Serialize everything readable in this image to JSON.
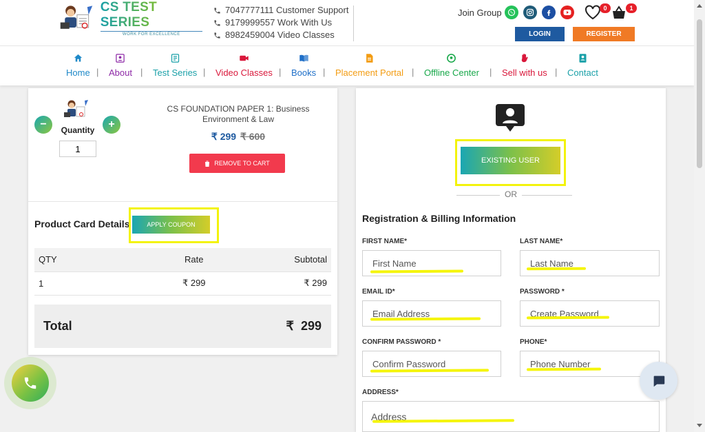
{
  "header": {
    "logo": {
      "title": "CS TEST SERIES",
      "tagline": "WORK FOR EXCELLENCE"
    },
    "contacts": [
      "7047777111 Customer Support",
      "9179999557 Work With Us",
      "8982459004 Video Classes"
    ],
    "join_group": "Join Group",
    "social_icons": [
      "whatsapp-icon",
      "instagram-icon",
      "facebook-icon",
      "youtube-icon"
    ],
    "wishlist_count": "0",
    "cart_count": "1",
    "login_label": "LOGIN",
    "register_label": "REGISTER"
  },
  "nav": {
    "items": [
      {
        "label": "Home",
        "icon": "home-icon",
        "color": "#1f89c8"
      },
      {
        "label": "About",
        "icon": "about-icon",
        "color": "#8e2aa7"
      },
      {
        "label": "Test Series",
        "icon": "list-icon",
        "color": "#1aa0a8"
      },
      {
        "label": "Video Classes",
        "icon": "video-icon",
        "color": "#d9183b"
      },
      {
        "label": "Books",
        "icon": "book-icon",
        "color": "#1f6fc8"
      },
      {
        "label": "Placement Portal",
        "icon": "document-icon",
        "color": "#f39c12"
      },
      {
        "label": "Offline Center",
        "icon": "location-icon",
        "color": "#18a84a"
      },
      {
        "label": "Sell with us",
        "icon": "hand-icon",
        "color": "#d9183b"
      },
      {
        "label": "Contact",
        "icon": "contact-icon",
        "color": "#1aa0a8"
      }
    ],
    "separator": "|"
  },
  "cart": {
    "minus": "−",
    "plus": "+",
    "quantity_label": "Quantity",
    "quantity_value": "1",
    "product_title": "CS FOUNDATION PAPER 1: Business Environment & Law",
    "price": "₹ 299",
    "original_price": "₹ 600",
    "remove_label": "REMOVE TO CART",
    "details_title": "Product Card Details",
    "apply_coupon": "APPLY COUPON",
    "table": {
      "headers": [
        "QTY",
        "Rate",
        "Subtotal"
      ],
      "rows": [
        [
          "1",
          "₹ 299",
          "₹ 299"
        ]
      ]
    },
    "total_label": "Total",
    "total_value": "₹  299"
  },
  "registration": {
    "existing_user": "EXISTING USER",
    "or": "OR",
    "title": "Registration & Billing Information",
    "fields": {
      "first_name": {
        "label": "FIRST NAME*",
        "placeholder": "First Name"
      },
      "last_name": {
        "label": "LAST NAME*",
        "placeholder": "Last Name"
      },
      "email": {
        "label": "EMAIL ID*",
        "placeholder": "Email Address"
      },
      "password": {
        "label": "PASSWORD *",
        "placeholder": "Create Password"
      },
      "confirm_password": {
        "label": "CONFIRM PASSWORD *",
        "placeholder": "Confirm Password"
      },
      "phone": {
        "label": "PHONE*",
        "placeholder": "Phone Number"
      },
      "address": {
        "label": "ADDRESS*",
        "placeholder": "Address"
      }
    }
  },
  "colors": {
    "highlight": "#f3f30c",
    "login": "#1e5aa0",
    "register": "#f07a25",
    "remove": "#f23a4d"
  }
}
